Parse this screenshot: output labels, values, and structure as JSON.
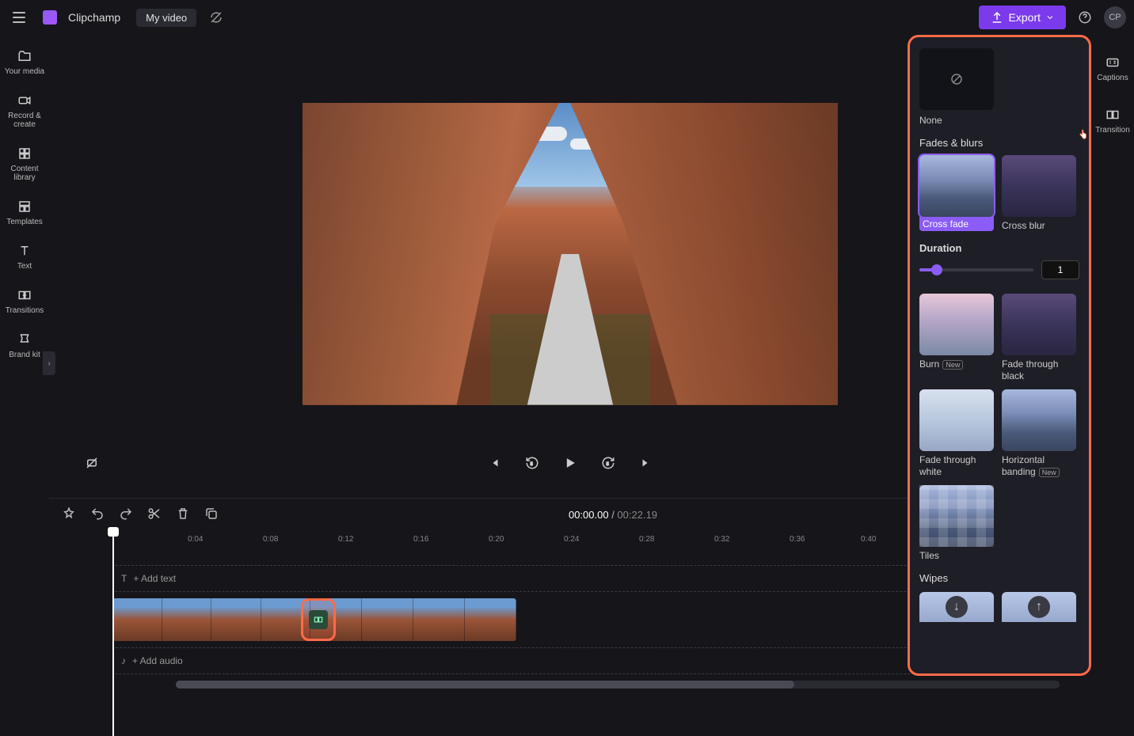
{
  "brand": "Clipchamp",
  "video_title": "My video",
  "export_label": "Export",
  "avatar_initials": "CP",
  "aspect_ratio": "16:9",
  "left_rail": [
    {
      "label": "Your media"
    },
    {
      "label": "Record & create"
    },
    {
      "label": "Content library"
    },
    {
      "label": "Templates"
    },
    {
      "label": "Text"
    },
    {
      "label": "Transitions"
    },
    {
      "label": "Brand kit"
    }
  ],
  "right_rail": [
    {
      "label": "Captions"
    },
    {
      "label": "Transition"
    }
  ],
  "player": {
    "current_time": "00:00.00",
    "duration": "00:22.19"
  },
  "timeline": {
    "ticks": [
      "0:04",
      "0:08",
      "0:12",
      "0:16",
      "0:20",
      "0:24",
      "0:28",
      "0:32",
      "0:36",
      "0:40"
    ],
    "add_text": "+ Add text",
    "add_audio": "+ Add audio"
  },
  "transitions_panel": {
    "none_label": "None",
    "section_fades": "Fades & blurs",
    "cross_fade": "Cross fade",
    "cross_blur": "Cross blur",
    "duration_label": "Duration",
    "duration_value": "1",
    "burn": "Burn",
    "new_badge": "New",
    "fade_black": "Fade through black",
    "fade_white": "Fade through white",
    "horiz_banding": "Horizontal banding",
    "tiles": "Tiles",
    "section_wipes": "Wipes"
  }
}
